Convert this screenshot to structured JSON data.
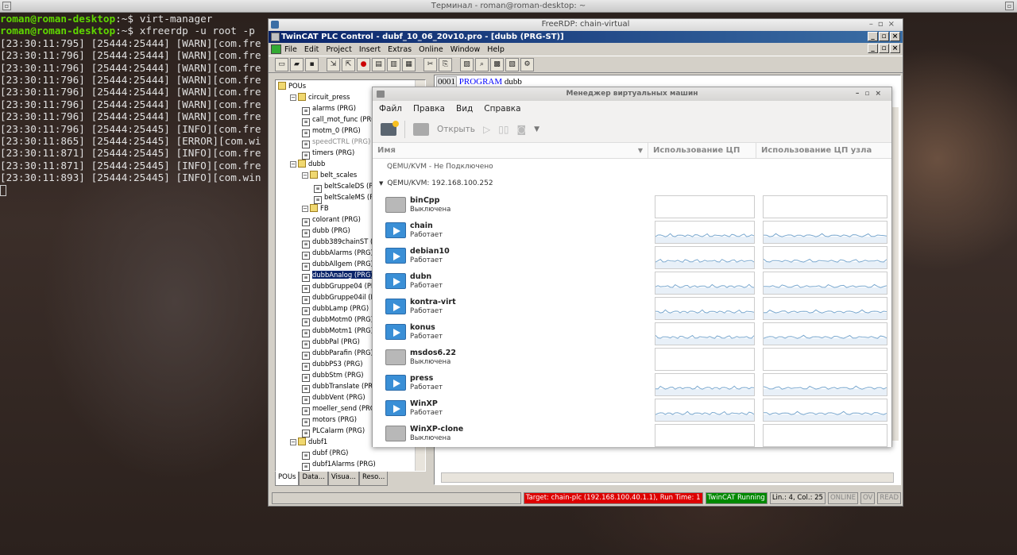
{
  "terminal": {
    "title": "Терминал - roman@roman-desktop: ~",
    "prompt": "roman@roman-desktop",
    "lines": [
      {
        "prompt": "roman@roman-desktop",
        "rest": ":~$ virt-manager"
      },
      {
        "prompt": "roman@roman-desktop",
        "rest": ":~$ xfreerdp -u root -p"
      },
      {
        "text": "[23:30:11:795] [25444:25444] [WARN][com.fre"
      },
      {
        "text": "[23:30:11:796] [25444:25444] [WARN][com.fre"
      },
      {
        "text": "[23:30:11:796] [25444:25444] [WARN][com.fre"
      },
      {
        "text": "[23:30:11:796] [25444:25444] [WARN][com.fre"
      },
      {
        "text": "[23:30:11:796] [25444:25444] [WARN][com.fre"
      },
      {
        "text": "[23:30:11:796] [25444:25444] [WARN][com.fre"
      },
      {
        "text": "[23:30:11:796] [25444:25444] [WARN][com.fre"
      },
      {
        "text": "[23:30:11:796] [25444:25445] [INFO][com.fre"
      },
      {
        "text": "[23:30:11:865] [25444:25445] [ERROR][com.wi"
      },
      {
        "text": "[23:30:11:871] [25444:25445] [INFO][com.fre"
      },
      {
        "text": "[23:30:11:871] [25444:25445] [INFO][com.fre"
      },
      {
        "text": "[23:30:11:893] [25444:25445] [INFO][com.win"
      }
    ]
  },
  "rdp": {
    "title": "FreeRDP: chain-virtual"
  },
  "twincat": {
    "title": "TwinCAT PLC Control - dubf_10_06_20v10.pro - [dubb (PRG-ST)]",
    "menu": [
      "File",
      "Edit",
      "Project",
      "Insert",
      "Extras",
      "Online",
      "Window",
      "Help"
    ],
    "tree": [
      {
        "t": "POUs",
        "lvl": 0,
        "type": "folder"
      },
      {
        "t": "circuit_press",
        "lvl": 1,
        "type": "folder"
      },
      {
        "t": "alarms (PRG)",
        "lvl": 2
      },
      {
        "t": "call_mot_func (PRG)",
        "lvl": 2
      },
      {
        "t": "motm_0 (PRG)",
        "lvl": 2
      },
      {
        "t": "speedCTRL (PRG)",
        "lvl": 2,
        "gray": true
      },
      {
        "t": "timers (PRG)",
        "lvl": 2
      },
      {
        "t": "dubb",
        "lvl": 1,
        "type": "folder"
      },
      {
        "t": "belt_scales",
        "lvl": 2,
        "type": "folder"
      },
      {
        "t": "beltScaleDS (PR",
        "lvl": 3
      },
      {
        "t": "beltScaleMS (PR",
        "lvl": 3
      },
      {
        "t": "FB",
        "lvl": 2,
        "type": "folder"
      },
      {
        "t": "colorant (PRG)",
        "lvl": 2
      },
      {
        "t": "dubb (PRG)",
        "lvl": 2
      },
      {
        "t": "dubb389chainST (P",
        "lvl": 2
      },
      {
        "t": "dubbAlarms (PRG)",
        "lvl": 2
      },
      {
        "t": "dubbAllgem (PRG)",
        "lvl": 2
      },
      {
        "t": "dubbAnalog (PRG)",
        "lvl": 2,
        "sel": true
      },
      {
        "t": "dubbGruppe04 (PRG",
        "lvl": 2
      },
      {
        "t": "dubbGruppe04il (PR",
        "lvl": 2
      },
      {
        "t": "dubbLamp (PRG)",
        "lvl": 2
      },
      {
        "t": "dubbMotm0 (PRG)",
        "lvl": 2
      },
      {
        "t": "dubbMotm1 (PRG)",
        "lvl": 2
      },
      {
        "t": "dubbPal (PRG)",
        "lvl": 2
      },
      {
        "t": "dubbParafin (PRG)",
        "lvl": 2
      },
      {
        "t": "dubbPS3 (PRG)",
        "lvl": 2
      },
      {
        "t": "dubbStm (PRG)",
        "lvl": 2
      },
      {
        "t": "dubbTranslate (PRG",
        "lvl": 2
      },
      {
        "t": "dubbVent (PRG)",
        "lvl": 2
      },
      {
        "t": "moeller_send (PRG)",
        "lvl": 2
      },
      {
        "t": "motors (PRG)",
        "lvl": 2
      },
      {
        "t": "PLCalarm (PRG)",
        "lvl": 2
      },
      {
        "t": "dubf1",
        "lvl": 1,
        "type": "folder"
      },
      {
        "t": "dubf (PRG)",
        "lvl": 2
      },
      {
        "t": "dubf1Alarms (PRG)",
        "lvl": 2
      }
    ],
    "tabs": [
      "POUs",
      "Data...",
      "Visua...",
      "Reso..."
    ],
    "editor": {
      "line_no": "0001",
      "keyword": "PROGRAM",
      "name": "dubb"
    },
    "status": {
      "target": "Target: chain-plc (192.168.100.40.1.1), Run Time: 1",
      "running": "TwinCAT Running",
      "pos": "Lin.: 4, Col.: 25",
      "online": "ONLINE",
      "ov": "OV",
      "read": "READ"
    }
  },
  "virtmanager": {
    "title": "Менеджер виртуальных машин",
    "menu": [
      "Файл",
      "Правка",
      "Вид",
      "Справка"
    ],
    "toolbar": {
      "open": "Открыть"
    },
    "columns": {
      "name": "Имя",
      "cpu": "Использование ЦП",
      "host_cpu": "Использование ЦП узла"
    },
    "conn_off": "QEMU/KVM - Не Подключено",
    "conn_on": "QEMU/KVM: 192.168.100.252",
    "vms": [
      {
        "name": "binCpp",
        "state": "Выключена",
        "running": false
      },
      {
        "name": "chain",
        "state": "Работает",
        "running": true
      },
      {
        "name": "debian10",
        "state": "Работает",
        "running": true
      },
      {
        "name": "dubn",
        "state": "Работает",
        "running": true
      },
      {
        "name": "kontra-virt",
        "state": "Работает",
        "running": true
      },
      {
        "name": "konus",
        "state": "Работает",
        "running": true
      },
      {
        "name": "msdos6.22",
        "state": "Выключена",
        "running": false
      },
      {
        "name": "press",
        "state": "Работает",
        "running": true
      },
      {
        "name": "WinXP",
        "state": "Работает",
        "running": true
      },
      {
        "name": "WinXP-clone",
        "state": "Выключена",
        "running": false
      }
    ],
    "graph_color": "#7aa8cf"
  }
}
